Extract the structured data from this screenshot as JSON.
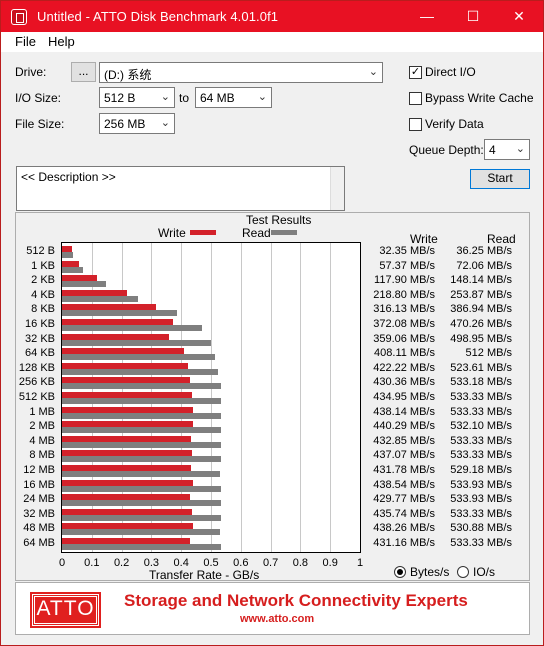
{
  "window": {
    "title": "Untitled - ATTO Disk Benchmark 4.01.0f1",
    "minimize_glyph": "—",
    "maximize_glyph": "☐",
    "close_glyph": "✕",
    "accent_color": "#e81123"
  },
  "menu": {
    "file": "File",
    "help": "Help"
  },
  "settings": {
    "drive_label": "Drive:",
    "browse_label": "...",
    "drive_value": "(D:) 系统",
    "io_size_label": "I/O Size:",
    "io_from": "512 B",
    "to_label": "to",
    "io_to": "64 MB",
    "file_size_label": "File Size:",
    "file_size": "256 MB"
  },
  "options": {
    "direct_io": {
      "label": "Direct I/O",
      "checked": true
    },
    "bypass_write_cache": {
      "label": "Bypass Write Cache",
      "checked": false
    },
    "verify_data": {
      "label": "Verify Data",
      "checked": false
    },
    "queue_depth_label": "Queue Depth:",
    "queue_depth": "4",
    "start_label": "Start"
  },
  "description_placeholder": "<< Description >>",
  "results": {
    "title": "Test Results",
    "legend_write": "Write",
    "legend_read": "Read",
    "col_write": "Write",
    "col_read": "Read",
    "x_axis_label": "Transfer Rate - GB/s",
    "units_bytes": "Bytes/s",
    "units_io": "IO/s",
    "selected_unit": "Bytes/s"
  },
  "chart_data": {
    "type": "bar",
    "title": "Test Results",
    "xlabel": "Transfer Rate - GB/s",
    "xlim": [
      0,
      1
    ],
    "xticks": [
      "0",
      "0.1",
      "0.2",
      "0.3",
      "0.4",
      "0.5",
      "0.6",
      "0.7",
      "0.8",
      "0.9",
      "1"
    ],
    "legend_position": "top",
    "grid": true,
    "colors": {
      "write": "#d3212a",
      "read": "#7f7f7f"
    },
    "categories": [
      "512 B",
      "1 KB",
      "2 KB",
      "4 KB",
      "8 KB",
      "16 KB",
      "32 KB",
      "64 KB",
      "128 KB",
      "256 KB",
      "512 KB",
      "1 MB",
      "2 MB",
      "4 MB",
      "8 MB",
      "12 MB",
      "16 MB",
      "24 MB",
      "32 MB",
      "48 MB",
      "64 MB"
    ],
    "series": [
      {
        "name": "Write",
        "values": [
          0.03235,
          0.05737,
          0.1179,
          0.2188,
          0.31613,
          0.37208,
          0.35906,
          0.40811,
          0.42222,
          0.43036,
          0.43495,
          0.43814,
          0.44029,
          0.43285,
          0.43707,
          0.43178,
          0.43854,
          0.42977,
          0.43574,
          0.43826,
          0.43116
        ],
        "labels": [
          "32.35 MB/s",
          "57.37 MB/s",
          "117.90 MB/s",
          "218.80 MB/s",
          "316.13 MB/s",
          "372.08 MB/s",
          "359.06 MB/s",
          "408.11 MB/s",
          "422.22 MB/s",
          "430.36 MB/s",
          "434.95 MB/s",
          "438.14 MB/s",
          "440.29 MB/s",
          "432.85 MB/s",
          "437.07 MB/s",
          "431.78 MB/s",
          "438.54 MB/s",
          "429.77 MB/s",
          "435.74 MB/s",
          "438.26 MB/s",
          "431.16 MB/s"
        ]
      },
      {
        "name": "Read",
        "values": [
          0.03625,
          0.07206,
          0.14814,
          0.25387,
          0.38694,
          0.47026,
          0.49895,
          0.512,
          0.52361,
          0.53318,
          0.53333,
          0.53333,
          0.5321,
          0.53333,
          0.53333,
          0.52918,
          0.53393,
          0.53393,
          0.53333,
          0.53088,
          0.53333
        ],
        "labels": [
          "36.25 MB/s",
          "72.06 MB/s",
          "148.14 MB/s",
          "253.87 MB/s",
          "386.94 MB/s",
          "470.26 MB/s",
          "498.95 MB/s",
          "512 MB/s",
          "523.61 MB/s",
          "533.18 MB/s",
          "533.33 MB/s",
          "533.33 MB/s",
          "532.10 MB/s",
          "533.33 MB/s",
          "533.33 MB/s",
          "529.18 MB/s",
          "533.93 MB/s",
          "533.93 MB/s",
          "533.33 MB/s",
          "530.88 MB/s",
          "533.33 MB/s"
        ]
      }
    ]
  },
  "banner": {
    "logo_text": "ATTO",
    "tagline": "Storage and Network Connectivity Experts",
    "url": "www.atto.com",
    "brand_color": "#d61e1e"
  }
}
